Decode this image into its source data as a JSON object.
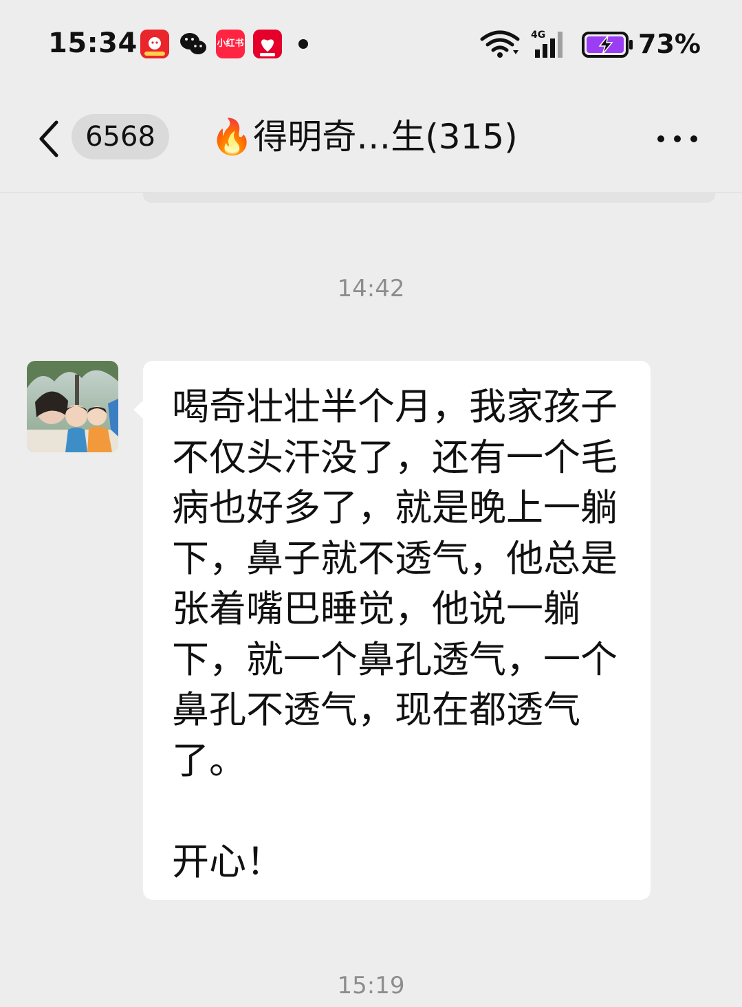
{
  "status_bar": {
    "time": "15:34",
    "notification_icons": [
      "app-promo-icon",
      "wechat-icon",
      "xiaohongshu-icon",
      "shopping-618-icon"
    ],
    "xhs_label": "小红书",
    "network": "4G",
    "battery": "73%",
    "battery_level": 0.73
  },
  "header": {
    "unread_count": "6568",
    "title": "🔥得明奇…生(315)"
  },
  "messages": {
    "timestamp_1": "14:42",
    "message_1": "喝奇壮壮半个月，我家孩子不仅头汗没了，还有一个毛病也好多了，就是晚上一躺下，鼻子就不透气，他总是张着嘴巴睡觉，他说一躺下，就一个鼻孔透气，一个鼻孔不透气，现在都透气了。\n\n开心！",
    "timestamp_2": "15:19"
  },
  "colors": {
    "background": "#ededed",
    "bubble": "#ffffff",
    "timestamp": "#8d8d8d",
    "battery_fill": "#9b3df2"
  }
}
